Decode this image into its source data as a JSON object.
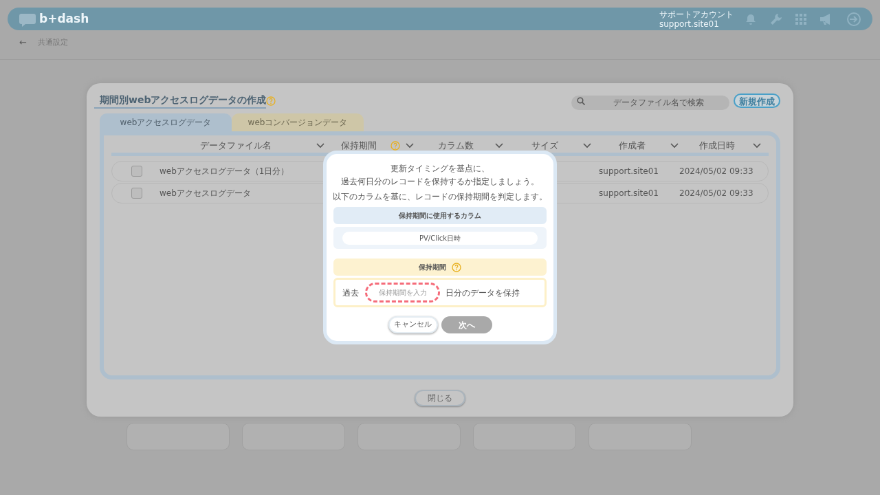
{
  "header": {
    "logo": "b+dash",
    "account_label": "サポートアカウント",
    "account_id": "support.site01"
  },
  "breadcrumb": {
    "back_icon": "←",
    "label": "共通設定"
  },
  "modal": {
    "title": "期間別webアクセスログデータの作成",
    "search": {
      "placeholder": "データファイル名で検索"
    },
    "new_button": "新規作成",
    "tabs": [
      {
        "label": "webアクセスログデータ",
        "selected": true
      },
      {
        "label": "webコンバージョンデータ",
        "selected": false
      }
    ],
    "columns": [
      {
        "label": "データファイル名",
        "help": false
      },
      {
        "label": "保持期間",
        "help": true
      },
      {
        "label": "カラム数",
        "help": false
      },
      {
        "label": "サイズ",
        "help": false
      },
      {
        "label": "作成者",
        "help": false
      },
      {
        "label": "作成日時",
        "help": false
      }
    ],
    "rows": [
      {
        "checked": false,
        "name": "webアクセスログデータ（1日分）",
        "creator": "support.site01",
        "created": "2024/05/02 09:33"
      },
      {
        "checked": false,
        "name": "webアクセスログデータ",
        "creator": "support.site01",
        "created": "2024/05/02 09:33"
      }
    ],
    "close_button": "閉じる"
  },
  "dialog": {
    "lines": [
      "更新タイミングを基点に、",
      "過去何日分のレコードを保持するか指定しましょう。"
    ],
    "note": "以下のカラムを基に、レコードの保持期間を判定します。",
    "column_section": {
      "title": "保持期間に使用するカラム",
      "value": "PV/Click日時"
    },
    "period_section": {
      "title": "保持期間",
      "prefix": "過去",
      "placeholder": "保持期間を入力",
      "suffix": "日分のデータを保持"
    },
    "cancel_button": "キャンセル",
    "next_button": {
      "label": "次へ",
      "disabled": true
    }
  }
}
